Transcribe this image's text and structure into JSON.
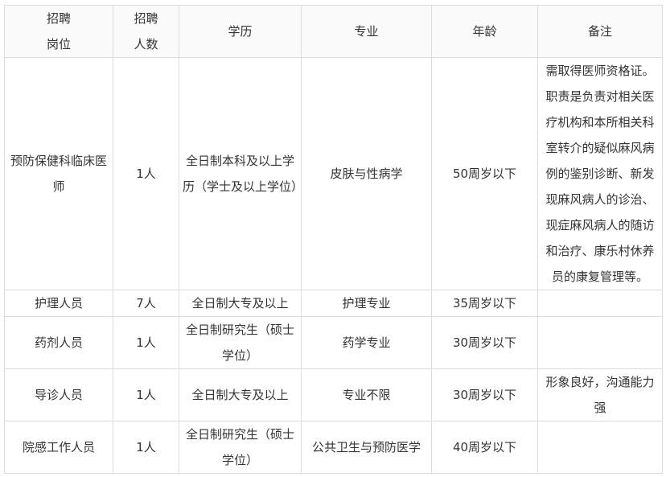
{
  "table": {
    "headers": [
      {
        "line1": "招聘",
        "line2": "岗位"
      },
      {
        "line1": "招聘",
        "line2": "人数"
      },
      {
        "line1": "学历",
        "line2": ""
      },
      {
        "line1": "专业",
        "line2": ""
      },
      {
        "line1": "年龄",
        "line2": ""
      },
      {
        "line1": "备注",
        "line2": ""
      }
    ],
    "rows": [
      {
        "position": "预防保健科临床医师",
        "count": "1人",
        "education": "全日制本科及以上学历（学士及以上学位）",
        "major": "皮肤与性病学",
        "age": "50周岁以下",
        "note": "需取得医师资格证。职责是负责对相关医疗机构和本所相关科室转介的疑似麻风病例的鉴别诊断、新发现麻风病人的诊治、现症麻风病人的随访和治疗、康乐村休养员的康复管理等。"
      },
      {
        "position": "护理人员",
        "count": "7人",
        "education": "全日制大专及以上",
        "major": "护理专业",
        "age": "35周岁以下",
        "note": ""
      },
      {
        "position": "药剂人员",
        "count": "1人",
        "education": "全日制研究生（硕士学位）",
        "major": "药学专业",
        "age": "30周岁以下",
        "note": ""
      },
      {
        "position": "导诊人员",
        "count": "1人",
        "education": "全日制大专及以上",
        "major": "专业不限",
        "age": "30周岁以下",
        "note": "形象良好，沟通能力强"
      },
      {
        "position": "院感工作人员",
        "count": "1人",
        "education": "全日制研究生（硕士学位）",
        "major": "公共卫生与预防医学",
        "age": "40周岁以下",
        "note": ""
      }
    ]
  }
}
